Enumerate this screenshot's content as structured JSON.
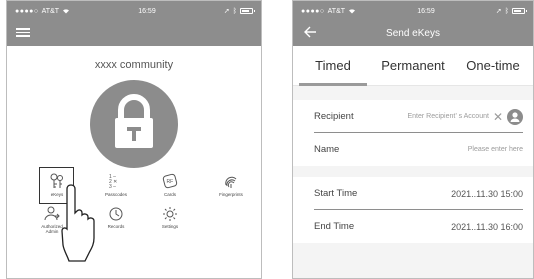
{
  "left_screen": {
    "status": {
      "carrier": "AT&T",
      "signal_dots": "●●●●○",
      "time": "16:59"
    },
    "community_title": "xxxx community",
    "functions": [
      {
        "id": "ekeys",
        "label": "eKeys",
        "icon": "ekeys-icon"
      },
      {
        "id": "passcodes",
        "label": "Passcodes",
        "icon": "passcode-icon"
      },
      {
        "id": "cards",
        "label": "Cards",
        "icon": "card-icon"
      },
      {
        "id": "fingerprints",
        "label": "Fingerprints",
        "icon": "fingerprint-icon"
      },
      {
        "id": "authorized-admin",
        "label": "Authorized\nAdmin",
        "icon": "admin-icon"
      },
      {
        "id": "records",
        "label": "Records",
        "icon": "history-icon"
      },
      {
        "id": "settings",
        "label": "Settings",
        "icon": "gear-icon"
      }
    ]
  },
  "right_screen": {
    "status": {
      "carrier": "AT&T",
      "signal_dots": "●●●●○",
      "time": "16:59"
    },
    "title": "Send eKeys",
    "tabs": [
      {
        "label": "Timed",
        "active": true
      },
      {
        "label": "Permanent",
        "active": false
      },
      {
        "label": "One-time",
        "active": false
      }
    ],
    "recipient": {
      "label": "Recipient",
      "placeholder": "Enter Recipient’ s Account"
    },
    "name": {
      "label": "Name",
      "placeholder": "Please enter here"
    },
    "start_time": {
      "label": "Start Time",
      "value": "2021..11.30 15:00"
    },
    "end_time": {
      "label": "End Time",
      "value": "2021..11.30 16:00"
    }
  },
  "colors": {
    "header": "#8d8d8d",
    "lock": "#8c8c8c",
    "background": "#f4f4f4"
  }
}
